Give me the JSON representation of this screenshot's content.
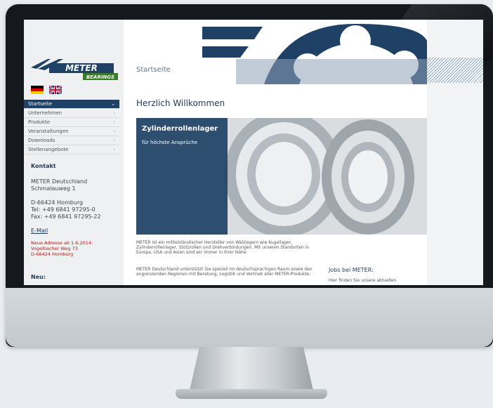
{
  "logo": {
    "brand": "METER",
    "sub": "BEARINGS"
  },
  "languages": [
    {
      "code": "de",
      "name": "Deutsch"
    },
    {
      "code": "en",
      "name": "English"
    }
  ],
  "nav": [
    {
      "label": "Startseite",
      "active": true
    },
    {
      "label": "Unternehmen",
      "active": false
    },
    {
      "label": "Produkte",
      "active": false
    },
    {
      "label": "Veranstaltungen",
      "active": false
    },
    {
      "label": "Downloads",
      "active": false
    },
    {
      "label": "Stellenangebote",
      "active": false
    }
  ],
  "contact": {
    "heading": "Kontakt",
    "company": "METER Deutschland\nSchmalauweg 1",
    "address": "D-66424 Homburg\nTel: +49 6841 97295-0\nFax: +49 6841 97295-22",
    "email_label": "E-Mail",
    "notice": "Neue Adresse ab 1.6.2014:\nVogelbacher Weg 73\nD-66424 Homburg",
    "new_heading": "Neu:"
  },
  "main": {
    "breadcrumb": "Startseite",
    "welcome": "Herzlich Willkommen",
    "hero_title": "Zylinderrollenlager",
    "hero_subtitle": "für höchste Ansprüche",
    "intro": "METER ist ein mittelständischer Hersteller von Wälzlagern wie Kugellager, Zylinderrollenlager, Stützrollen und Drehverbindungen. Mit unseren Standorten in Europa, USA und Asien sind wir immer in Ihrer Nähe.",
    "intro2": "METER Deutschland unterstützt Sie speziell im deutschsprachigen Raum sowie den angrenzenden Regionen mit Beratung, Logistik und Vertrieb aller METER-Produkte.",
    "jobs_title": "Jobs bei METER:",
    "jobs_text": "Hier finden Sie unsere aktuellen"
  },
  "colors": {
    "navy": "#1f4166",
    "accent_blue": "#5c7896",
    "notice_red": "#b01e1e"
  }
}
